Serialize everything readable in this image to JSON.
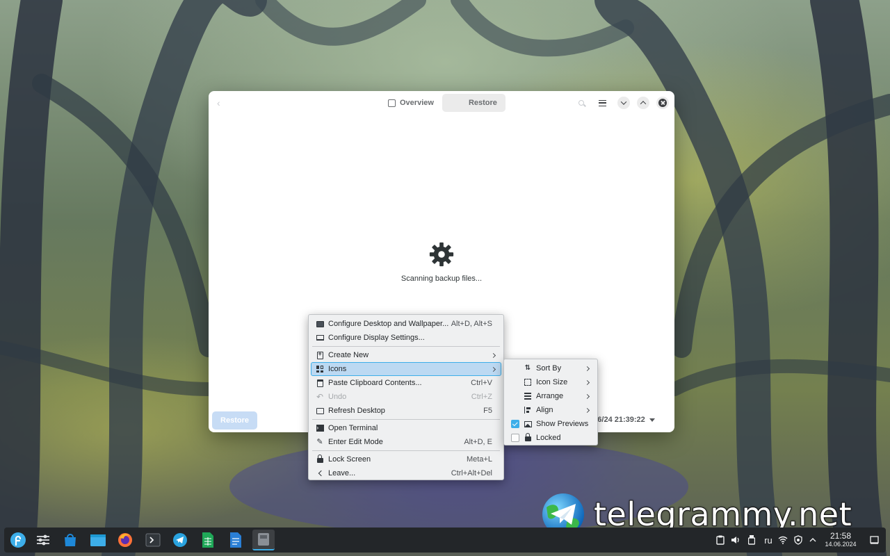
{
  "window": {
    "tabs": [
      {
        "label": "Overview",
        "icon": "overview-icon"
      },
      {
        "label": "Restore",
        "icon": "clock-icon"
      }
    ],
    "status_text": "Scanning backup files...",
    "restore_button": "Restore",
    "backup_date": "5/16/24 21:39:22"
  },
  "context_menu": {
    "items": [
      {
        "label": "Configure Desktop and Wallpaper...",
        "shortcut": "Alt+D, Alt+S",
        "icon": "desktop-wallpaper-icon"
      },
      {
        "label": "Configure Display Settings...",
        "shortcut": "",
        "icon": "display-icon"
      },
      {
        "label": "Create New",
        "shortcut": "",
        "icon": "new-document-icon",
        "submenu": true
      },
      {
        "label": "Icons",
        "shortcut": "",
        "icon": "icons-grid-icon",
        "submenu": true,
        "highlighted": true
      },
      {
        "label": "Paste Clipboard Contents...",
        "shortcut": "Ctrl+V",
        "icon": "clipboard-icon"
      },
      {
        "label": "Undo",
        "shortcut": "Ctrl+Z",
        "icon": "undo-icon",
        "disabled": true
      },
      {
        "label": "Refresh Desktop",
        "shortcut": "F5",
        "icon": "refresh-icon"
      },
      {
        "label": "Open Terminal",
        "shortcut": "",
        "icon": "terminal-icon"
      },
      {
        "label": "Enter Edit Mode",
        "shortcut": "Alt+D, E",
        "icon": "pencil-icon"
      },
      {
        "label": "Lock Screen",
        "shortcut": "Meta+L",
        "icon": "lock-icon"
      },
      {
        "label": "Leave...",
        "shortcut": "Ctrl+Alt+Del",
        "icon": "leave-icon"
      }
    ]
  },
  "icons_submenu": {
    "items": [
      {
        "label": "Sort By",
        "icon": "sort-icon",
        "submenu": true
      },
      {
        "label": "Icon Size",
        "icon": "icon-size-icon",
        "submenu": true
      },
      {
        "label": "Arrange",
        "icon": "arrange-icon",
        "submenu": true
      },
      {
        "label": "Align",
        "icon": "align-icon",
        "submenu": true
      },
      {
        "label": "Show Previews",
        "icon": "image-icon",
        "checked": true
      },
      {
        "label": "Locked",
        "icon": "lock-icon",
        "checked": false
      }
    ]
  },
  "watermark": {
    "text": "telegrammy.net"
  },
  "taskbar": {
    "apps": [
      "fedora-launcher-icon",
      "settings-sliders-icon",
      "discover-store-icon",
      "file-manager-icon",
      "firefox-icon",
      "terminal-icon",
      "telegram-icon",
      "spreadsheet-icon",
      "document-icon",
      "backup-app-icon"
    ],
    "keyboard_layout": "ru",
    "time": "21:58",
    "date": "14.06.2024"
  },
  "colors": {
    "accent": "#3daee9",
    "menu_bg": "#eff0f1",
    "taskbar_bg": "#232629",
    "highlight_bg": "#bcd9f2"
  }
}
